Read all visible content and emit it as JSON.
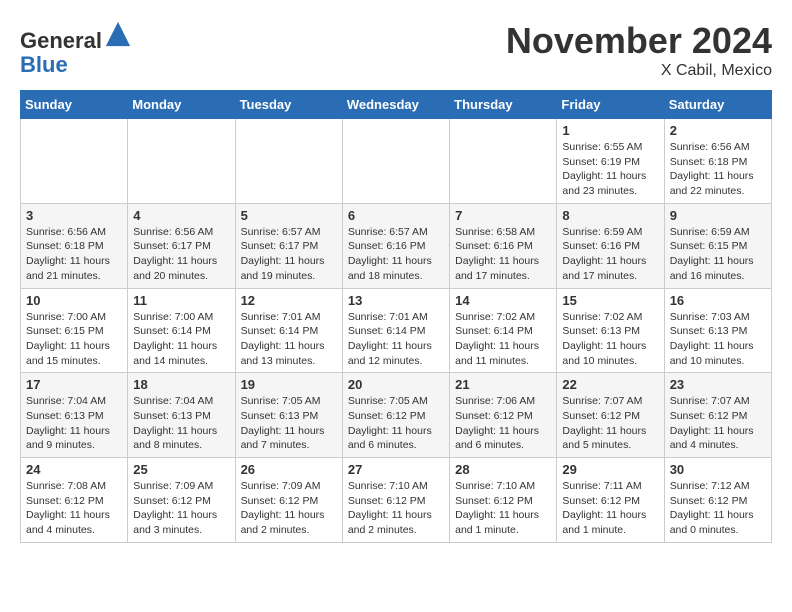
{
  "header": {
    "logo_general": "General",
    "logo_blue": "Blue",
    "month_title": "November 2024",
    "location": "X Cabil, Mexico"
  },
  "calendar": {
    "days_of_week": [
      "Sunday",
      "Monday",
      "Tuesday",
      "Wednesday",
      "Thursday",
      "Friday",
      "Saturday"
    ],
    "weeks": [
      [
        {
          "day": "",
          "info": ""
        },
        {
          "day": "",
          "info": ""
        },
        {
          "day": "",
          "info": ""
        },
        {
          "day": "",
          "info": ""
        },
        {
          "day": "",
          "info": ""
        },
        {
          "day": "1",
          "info": "Sunrise: 6:55 AM\nSunset: 6:19 PM\nDaylight: 11 hours and 23 minutes."
        },
        {
          "day": "2",
          "info": "Sunrise: 6:56 AM\nSunset: 6:18 PM\nDaylight: 11 hours and 22 minutes."
        }
      ],
      [
        {
          "day": "3",
          "info": "Sunrise: 6:56 AM\nSunset: 6:18 PM\nDaylight: 11 hours and 21 minutes."
        },
        {
          "day": "4",
          "info": "Sunrise: 6:56 AM\nSunset: 6:17 PM\nDaylight: 11 hours and 20 minutes."
        },
        {
          "day": "5",
          "info": "Sunrise: 6:57 AM\nSunset: 6:17 PM\nDaylight: 11 hours and 19 minutes."
        },
        {
          "day": "6",
          "info": "Sunrise: 6:57 AM\nSunset: 6:16 PM\nDaylight: 11 hours and 18 minutes."
        },
        {
          "day": "7",
          "info": "Sunrise: 6:58 AM\nSunset: 6:16 PM\nDaylight: 11 hours and 17 minutes."
        },
        {
          "day": "8",
          "info": "Sunrise: 6:59 AM\nSunset: 6:16 PM\nDaylight: 11 hours and 17 minutes."
        },
        {
          "day": "9",
          "info": "Sunrise: 6:59 AM\nSunset: 6:15 PM\nDaylight: 11 hours and 16 minutes."
        }
      ],
      [
        {
          "day": "10",
          "info": "Sunrise: 7:00 AM\nSunset: 6:15 PM\nDaylight: 11 hours and 15 minutes."
        },
        {
          "day": "11",
          "info": "Sunrise: 7:00 AM\nSunset: 6:14 PM\nDaylight: 11 hours and 14 minutes."
        },
        {
          "day": "12",
          "info": "Sunrise: 7:01 AM\nSunset: 6:14 PM\nDaylight: 11 hours and 13 minutes."
        },
        {
          "day": "13",
          "info": "Sunrise: 7:01 AM\nSunset: 6:14 PM\nDaylight: 11 hours and 12 minutes."
        },
        {
          "day": "14",
          "info": "Sunrise: 7:02 AM\nSunset: 6:14 PM\nDaylight: 11 hours and 11 minutes."
        },
        {
          "day": "15",
          "info": "Sunrise: 7:02 AM\nSunset: 6:13 PM\nDaylight: 11 hours and 10 minutes."
        },
        {
          "day": "16",
          "info": "Sunrise: 7:03 AM\nSunset: 6:13 PM\nDaylight: 11 hours and 10 minutes."
        }
      ],
      [
        {
          "day": "17",
          "info": "Sunrise: 7:04 AM\nSunset: 6:13 PM\nDaylight: 11 hours and 9 minutes."
        },
        {
          "day": "18",
          "info": "Sunrise: 7:04 AM\nSunset: 6:13 PM\nDaylight: 11 hours and 8 minutes."
        },
        {
          "day": "19",
          "info": "Sunrise: 7:05 AM\nSunset: 6:13 PM\nDaylight: 11 hours and 7 minutes."
        },
        {
          "day": "20",
          "info": "Sunrise: 7:05 AM\nSunset: 6:12 PM\nDaylight: 11 hours and 6 minutes."
        },
        {
          "day": "21",
          "info": "Sunrise: 7:06 AM\nSunset: 6:12 PM\nDaylight: 11 hours and 6 minutes."
        },
        {
          "day": "22",
          "info": "Sunrise: 7:07 AM\nSunset: 6:12 PM\nDaylight: 11 hours and 5 minutes."
        },
        {
          "day": "23",
          "info": "Sunrise: 7:07 AM\nSunset: 6:12 PM\nDaylight: 11 hours and 4 minutes."
        }
      ],
      [
        {
          "day": "24",
          "info": "Sunrise: 7:08 AM\nSunset: 6:12 PM\nDaylight: 11 hours and 4 minutes."
        },
        {
          "day": "25",
          "info": "Sunrise: 7:09 AM\nSunset: 6:12 PM\nDaylight: 11 hours and 3 minutes."
        },
        {
          "day": "26",
          "info": "Sunrise: 7:09 AM\nSunset: 6:12 PM\nDaylight: 11 hours and 2 minutes."
        },
        {
          "day": "27",
          "info": "Sunrise: 7:10 AM\nSunset: 6:12 PM\nDaylight: 11 hours and 2 minutes."
        },
        {
          "day": "28",
          "info": "Sunrise: 7:10 AM\nSunset: 6:12 PM\nDaylight: 11 hours and 1 minute."
        },
        {
          "day": "29",
          "info": "Sunrise: 7:11 AM\nSunset: 6:12 PM\nDaylight: 11 hours and 1 minute."
        },
        {
          "day": "30",
          "info": "Sunrise: 7:12 AM\nSunset: 6:12 PM\nDaylight: 11 hours and 0 minutes."
        }
      ]
    ]
  }
}
